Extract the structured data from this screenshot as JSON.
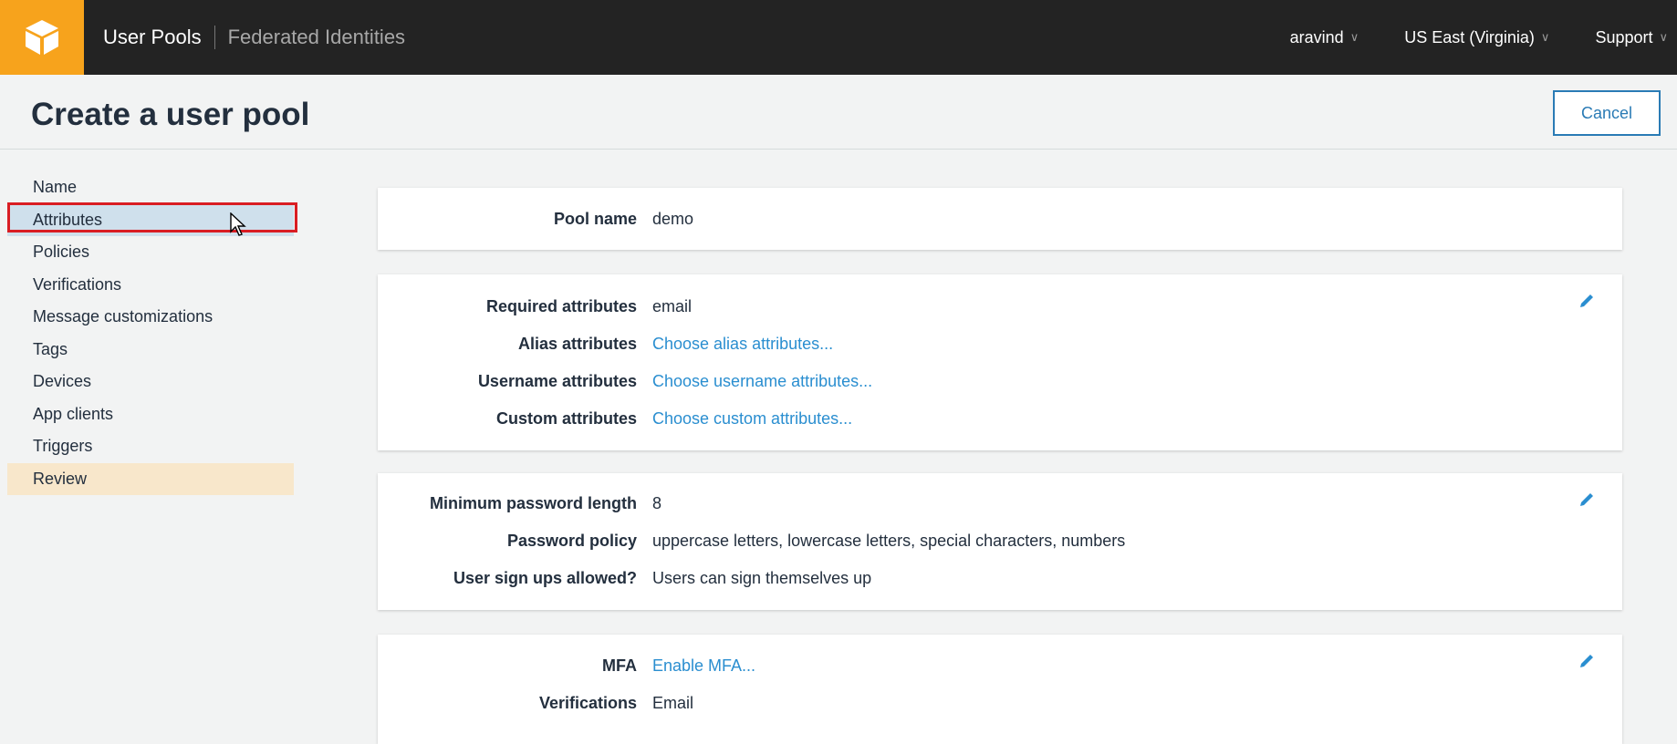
{
  "topbar": {
    "logo_icon": "aws-cube-icon",
    "tabs": [
      "User Pools",
      "Federated Identities"
    ],
    "user": "aravind",
    "region": "US East (Virginia)",
    "support": "Support"
  },
  "header": {
    "title": "Create a user pool",
    "cancel_label": "Cancel"
  },
  "sidebar": {
    "items": [
      {
        "label": "Name"
      },
      {
        "label": "Attributes"
      },
      {
        "label": "Policies"
      },
      {
        "label": "Verifications"
      },
      {
        "label": "Message customizations"
      },
      {
        "label": "Tags"
      },
      {
        "label": "Devices"
      },
      {
        "label": "App clients"
      },
      {
        "label": "Triggers"
      },
      {
        "label": "Review"
      }
    ],
    "selected": "Attributes",
    "current": "Review"
  },
  "cards": {
    "pool": {
      "label": "Pool name",
      "value": "demo"
    },
    "attributes": [
      {
        "label": "Required attributes",
        "value": "email"
      },
      {
        "label": "Alias attributes",
        "value": "Choose alias attributes..."
      },
      {
        "label": "Username attributes",
        "value": "Choose username attributes..."
      },
      {
        "label": "Custom attributes",
        "value": "Choose custom attributes..."
      }
    ],
    "policies": [
      {
        "label": "Minimum password length",
        "value": "8"
      },
      {
        "label": "Password policy",
        "value": "uppercase letters, lowercase letters, special characters, numbers"
      },
      {
        "label": "User sign ups allowed?",
        "value": "Users can sign themselves up"
      }
    ],
    "mfa": [
      {
        "label": "MFA",
        "value": "Enable MFA..."
      },
      {
        "label": "Verifications",
        "value": "Email"
      }
    ]
  },
  "colors": {
    "topbar": "#232323",
    "logo": "#f7a31c",
    "link": "#2a8ed0",
    "selected_bg": "#cfe0ec",
    "current_bg": "#f8e7cb",
    "highlight": "#d91d23"
  }
}
